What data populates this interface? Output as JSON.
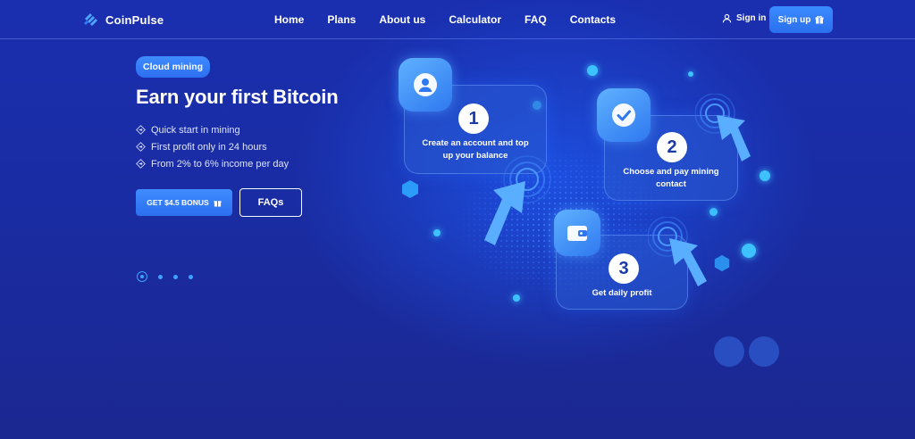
{
  "brand": {
    "name": "CoinPulse"
  },
  "nav": [
    {
      "label": "Home"
    },
    {
      "label": "Plans"
    },
    {
      "label": "About us"
    },
    {
      "label": "Calculator"
    },
    {
      "label": "FAQ"
    },
    {
      "label": "Contacts"
    }
  ],
  "auth": {
    "signin_label": "Sign in",
    "signup_label": "Sign up"
  },
  "hero": {
    "badge": "Cloud mining",
    "headline": "Earn your first Bitcoin",
    "features": [
      "Quick start in mining",
      "First profit only in 24 hours",
      "From 2% to 6% income per day"
    ],
    "bonus_button": "GET $4.5 BONUS",
    "faqs_button": "FAQs"
  },
  "slider": {
    "count": 4,
    "active_index": 0
  },
  "steps": [
    {
      "number": "1",
      "text_line1": "Create an account and top",
      "text_line2": "up your balance",
      "icon": "user-icon"
    },
    {
      "number": "2",
      "text_line1": "Choose and pay mining",
      "text_line2": "contact",
      "icon": "check-icon"
    },
    {
      "number": "3",
      "text_line1": "Get daily profit",
      "text_line2": "",
      "icon": "wallet-icon"
    }
  ],
  "colors": {
    "accent": "#2f7bff",
    "background": "#1a2ca3",
    "highlight": "#3ec1ff"
  }
}
